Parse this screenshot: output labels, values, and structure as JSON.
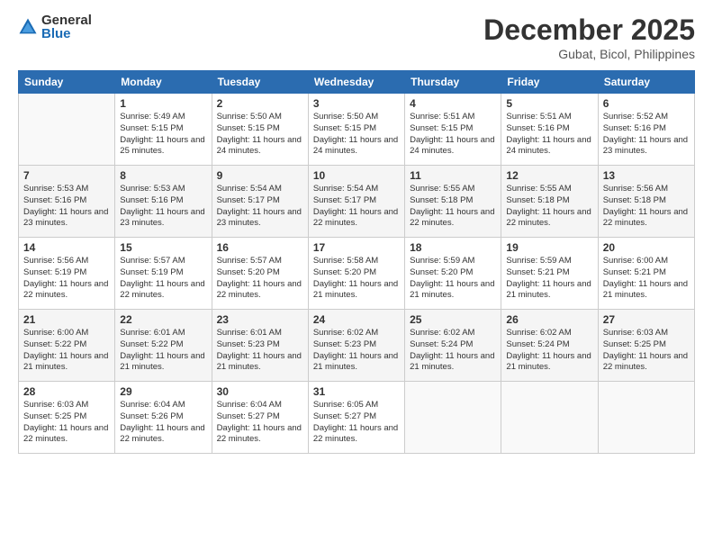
{
  "header": {
    "logo_general": "General",
    "logo_blue": "Blue",
    "month_title": "December 2025",
    "location": "Gubat, Bicol, Philippines"
  },
  "weekdays": [
    "Sunday",
    "Monday",
    "Tuesday",
    "Wednesday",
    "Thursday",
    "Friday",
    "Saturday"
  ],
  "weeks": [
    [
      {
        "day": null
      },
      {
        "day": "1",
        "sunrise": "5:49 AM",
        "sunset": "5:15 PM",
        "daylight": "11 hours and 25 minutes."
      },
      {
        "day": "2",
        "sunrise": "5:50 AM",
        "sunset": "5:15 PM",
        "daylight": "11 hours and 24 minutes."
      },
      {
        "day": "3",
        "sunrise": "5:50 AM",
        "sunset": "5:15 PM",
        "daylight": "11 hours and 24 minutes."
      },
      {
        "day": "4",
        "sunrise": "5:51 AM",
        "sunset": "5:15 PM",
        "daylight": "11 hours and 24 minutes."
      },
      {
        "day": "5",
        "sunrise": "5:51 AM",
        "sunset": "5:16 PM",
        "daylight": "11 hours and 24 minutes."
      },
      {
        "day": "6",
        "sunrise": "5:52 AM",
        "sunset": "5:16 PM",
        "daylight": "11 hours and 23 minutes."
      }
    ],
    [
      {
        "day": "7",
        "sunrise": "5:53 AM",
        "sunset": "5:16 PM",
        "daylight": "11 hours and 23 minutes."
      },
      {
        "day": "8",
        "sunrise": "5:53 AM",
        "sunset": "5:16 PM",
        "daylight": "11 hours and 23 minutes."
      },
      {
        "day": "9",
        "sunrise": "5:54 AM",
        "sunset": "5:17 PM",
        "daylight": "11 hours and 23 minutes."
      },
      {
        "day": "10",
        "sunrise": "5:54 AM",
        "sunset": "5:17 PM",
        "daylight": "11 hours and 22 minutes."
      },
      {
        "day": "11",
        "sunrise": "5:55 AM",
        "sunset": "5:18 PM",
        "daylight": "11 hours and 22 minutes."
      },
      {
        "day": "12",
        "sunrise": "5:55 AM",
        "sunset": "5:18 PM",
        "daylight": "11 hours and 22 minutes."
      },
      {
        "day": "13",
        "sunrise": "5:56 AM",
        "sunset": "5:18 PM",
        "daylight": "11 hours and 22 minutes."
      }
    ],
    [
      {
        "day": "14",
        "sunrise": "5:56 AM",
        "sunset": "5:19 PM",
        "daylight": "11 hours and 22 minutes."
      },
      {
        "day": "15",
        "sunrise": "5:57 AM",
        "sunset": "5:19 PM",
        "daylight": "11 hours and 22 minutes."
      },
      {
        "day": "16",
        "sunrise": "5:57 AM",
        "sunset": "5:20 PM",
        "daylight": "11 hours and 22 minutes."
      },
      {
        "day": "17",
        "sunrise": "5:58 AM",
        "sunset": "5:20 PM",
        "daylight": "11 hours and 21 minutes."
      },
      {
        "day": "18",
        "sunrise": "5:59 AM",
        "sunset": "5:20 PM",
        "daylight": "11 hours and 21 minutes."
      },
      {
        "day": "19",
        "sunrise": "5:59 AM",
        "sunset": "5:21 PM",
        "daylight": "11 hours and 21 minutes."
      },
      {
        "day": "20",
        "sunrise": "6:00 AM",
        "sunset": "5:21 PM",
        "daylight": "11 hours and 21 minutes."
      }
    ],
    [
      {
        "day": "21",
        "sunrise": "6:00 AM",
        "sunset": "5:22 PM",
        "daylight": "11 hours and 21 minutes."
      },
      {
        "day": "22",
        "sunrise": "6:01 AM",
        "sunset": "5:22 PM",
        "daylight": "11 hours and 21 minutes."
      },
      {
        "day": "23",
        "sunrise": "6:01 AM",
        "sunset": "5:23 PM",
        "daylight": "11 hours and 21 minutes."
      },
      {
        "day": "24",
        "sunrise": "6:02 AM",
        "sunset": "5:23 PM",
        "daylight": "11 hours and 21 minutes."
      },
      {
        "day": "25",
        "sunrise": "6:02 AM",
        "sunset": "5:24 PM",
        "daylight": "11 hours and 21 minutes."
      },
      {
        "day": "26",
        "sunrise": "6:02 AM",
        "sunset": "5:24 PM",
        "daylight": "11 hours and 21 minutes."
      },
      {
        "day": "27",
        "sunrise": "6:03 AM",
        "sunset": "5:25 PM",
        "daylight": "11 hours and 22 minutes."
      }
    ],
    [
      {
        "day": "28",
        "sunrise": "6:03 AM",
        "sunset": "5:25 PM",
        "daylight": "11 hours and 22 minutes."
      },
      {
        "day": "29",
        "sunrise": "6:04 AM",
        "sunset": "5:26 PM",
        "daylight": "11 hours and 22 minutes."
      },
      {
        "day": "30",
        "sunrise": "6:04 AM",
        "sunset": "5:27 PM",
        "daylight": "11 hours and 22 minutes."
      },
      {
        "day": "31",
        "sunrise": "6:05 AM",
        "sunset": "5:27 PM",
        "daylight": "11 hours and 22 minutes."
      },
      {
        "day": null
      },
      {
        "day": null
      },
      {
        "day": null
      }
    ]
  ],
  "labels": {
    "sunrise_prefix": "Sunrise: ",
    "sunset_prefix": "Sunset: ",
    "daylight_prefix": "Daylight: "
  }
}
